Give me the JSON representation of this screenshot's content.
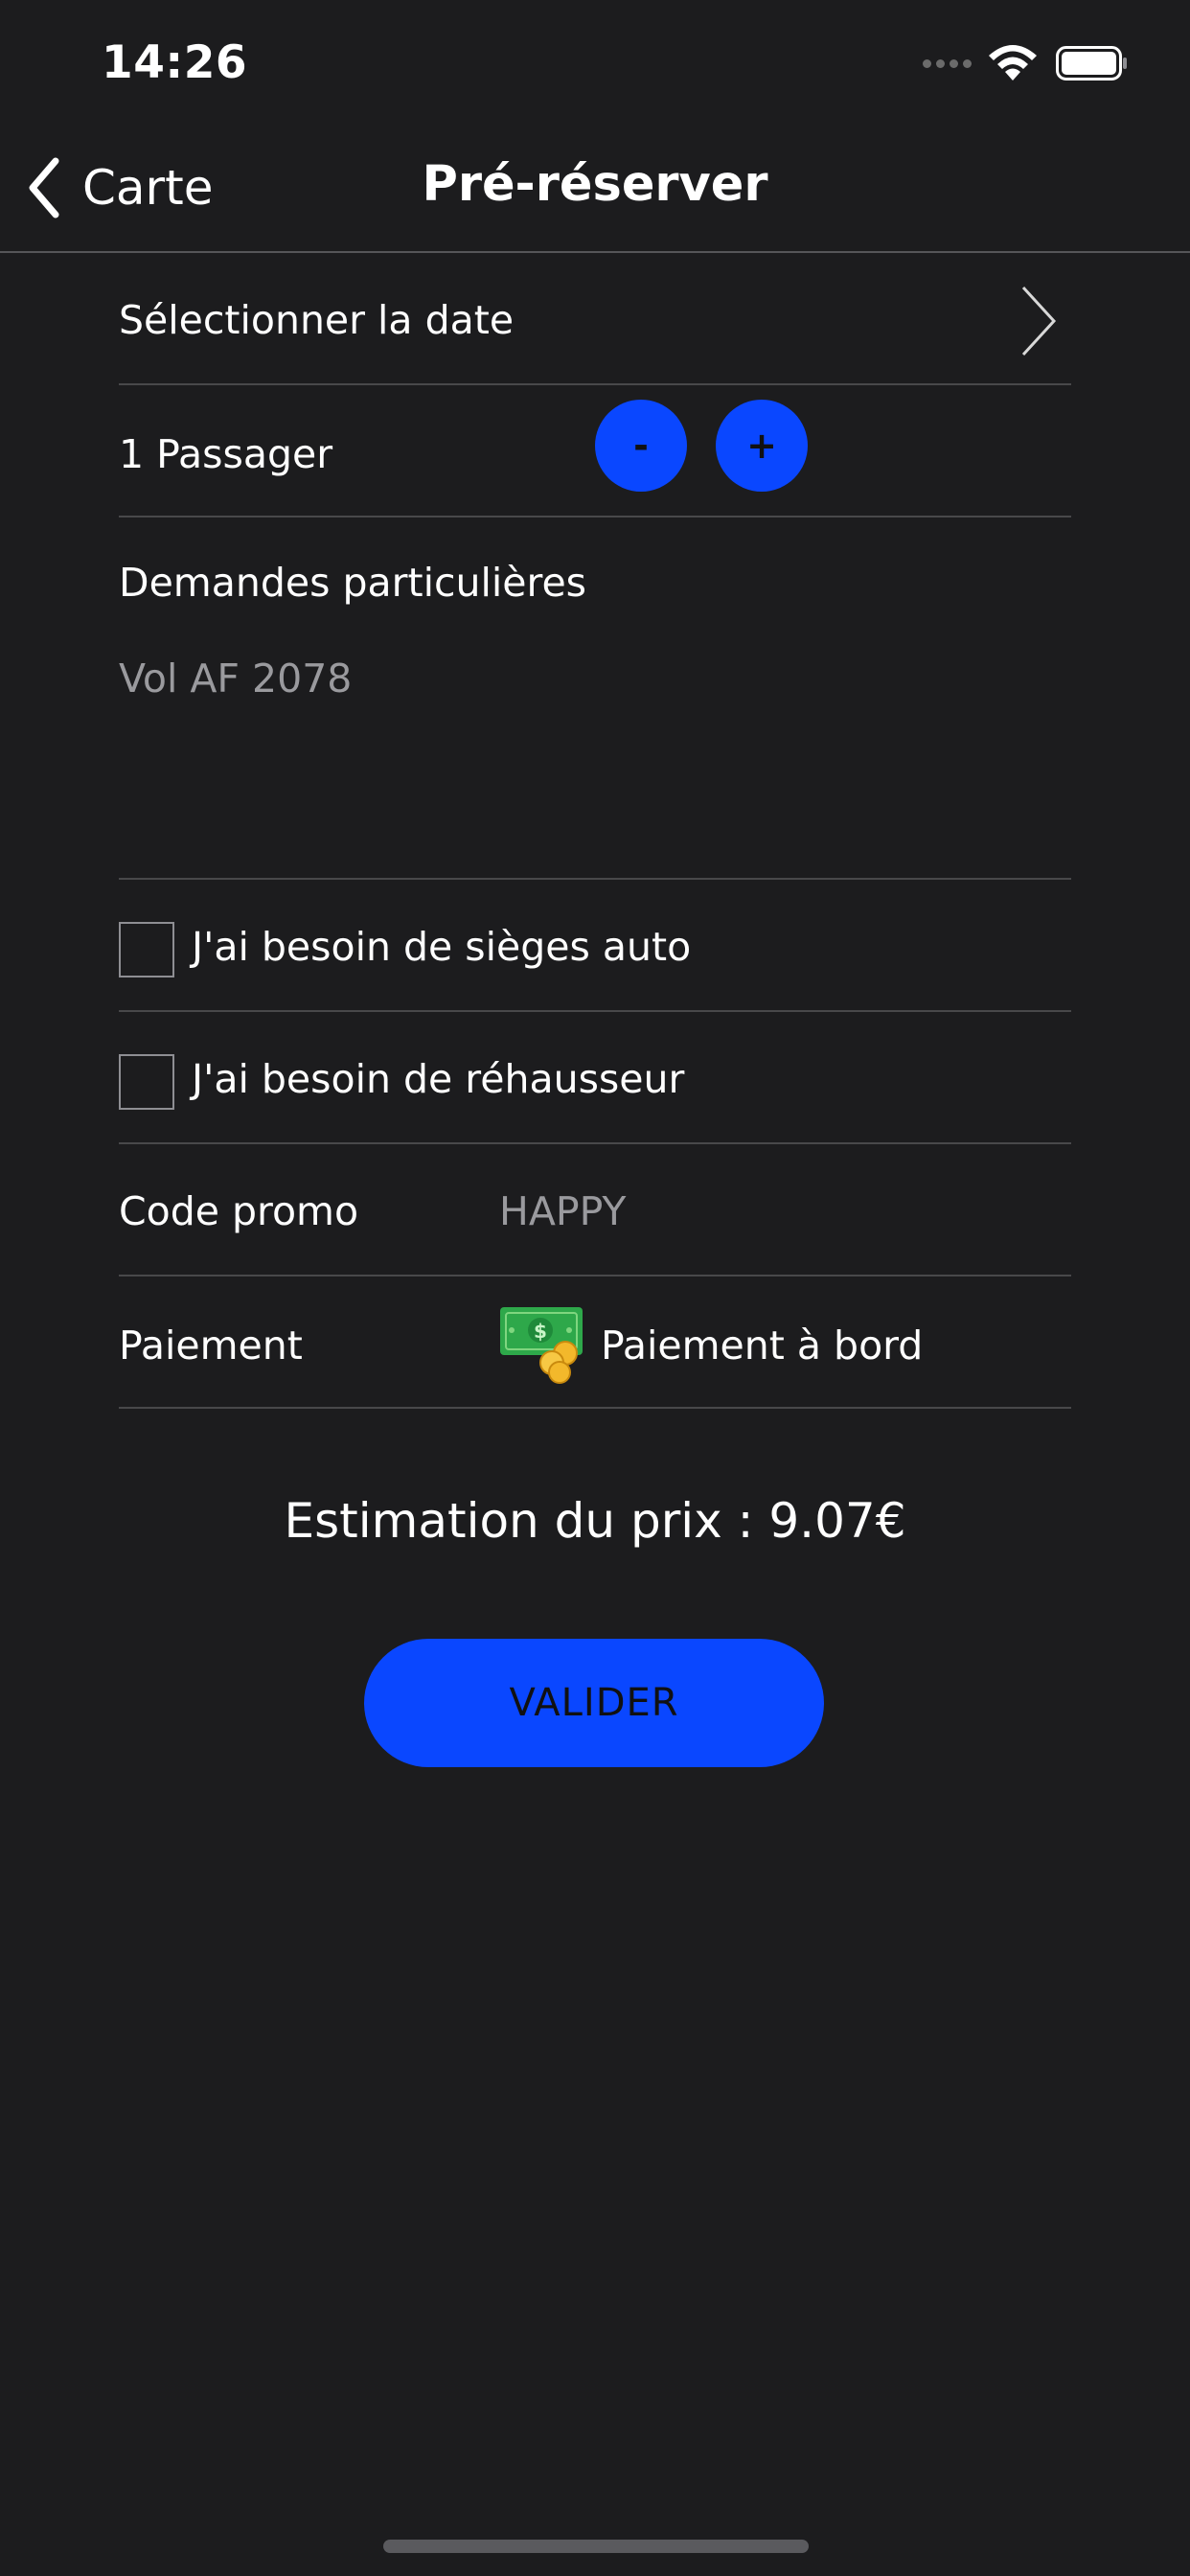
{
  "status_bar": {
    "time": "14:26",
    "icons": [
      "signal-dots-icon",
      "wifi-icon",
      "battery-icon"
    ]
  },
  "nav": {
    "back_label": "Carte",
    "title": "Pré-réserver"
  },
  "form": {
    "date": {
      "label": "Sélectionner la date",
      "icon": "chevron-right-icon"
    },
    "passengers": {
      "label": "1 Passager",
      "minus_label": "-",
      "plus_label": "+"
    },
    "requests": {
      "label": "Demandes particulières",
      "value": "Vol AF 2078"
    },
    "car_seat": {
      "label": "J'ai besoin de sièges auto",
      "checked": false
    },
    "booster": {
      "label": "J'ai besoin de réhausseur",
      "checked": false
    },
    "promo": {
      "label": "Code promo",
      "value": "HAPPY"
    },
    "payment": {
      "label": "Paiement",
      "icon": "money-icon",
      "value": "Paiement à bord"
    }
  },
  "estimate": "Estimation du prix : 9.07€",
  "submit_label": "VALIDER",
  "colors": {
    "background": "#1c1c1e",
    "accent": "#0a47ff",
    "divider": "#48484a",
    "secondary_text": "#9a9a9e"
  }
}
